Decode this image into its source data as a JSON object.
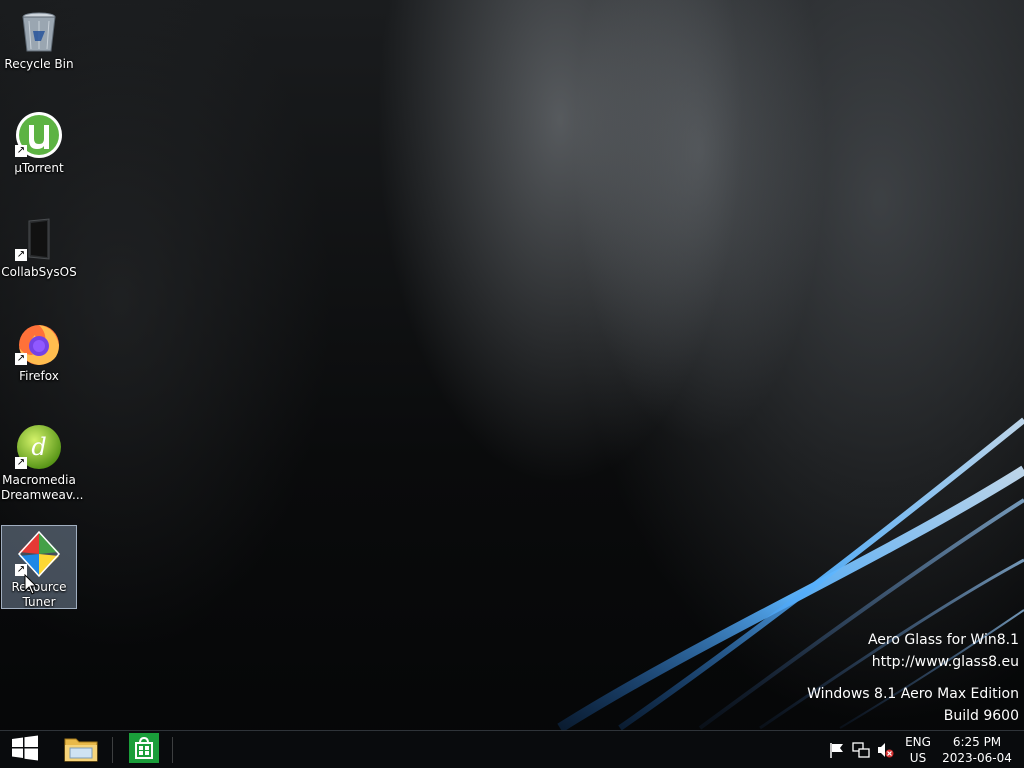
{
  "desktop": {
    "icons": [
      {
        "label": "Recycle Bin",
        "icon": "recycle-bin-icon"
      },
      {
        "label": "µTorrent",
        "icon": "utorrent-icon"
      },
      {
        "label": "CollabSysOS",
        "icon": "collabsysos-icon"
      },
      {
        "label": "Firefox",
        "icon": "firefox-icon"
      },
      {
        "label": "Macromedia Dreamweav...",
        "icon": "dreamweaver-icon"
      },
      {
        "label": "Resource Tuner",
        "icon": "resource-tuner-icon"
      }
    ]
  },
  "watermark": {
    "line1": "Aero Glass for Win8.1",
    "line2": "http://www.glass8.eu",
    "line3": "Windows 8.1 Aero Max Edition",
    "line4": "Build 9600"
  },
  "taskbar": {
    "pinned": [
      "start-button",
      "file-explorer",
      "store"
    ],
    "tray": {
      "lang_line1": "ENG",
      "lang_line2": "US",
      "time": "6:25 PM",
      "date": "2023-06-04"
    }
  },
  "colors": {
    "taskbar_bg": "#0a0c0e",
    "selection": "#8ca0b9",
    "wallpaper_accent": "#3aa0ff"
  }
}
